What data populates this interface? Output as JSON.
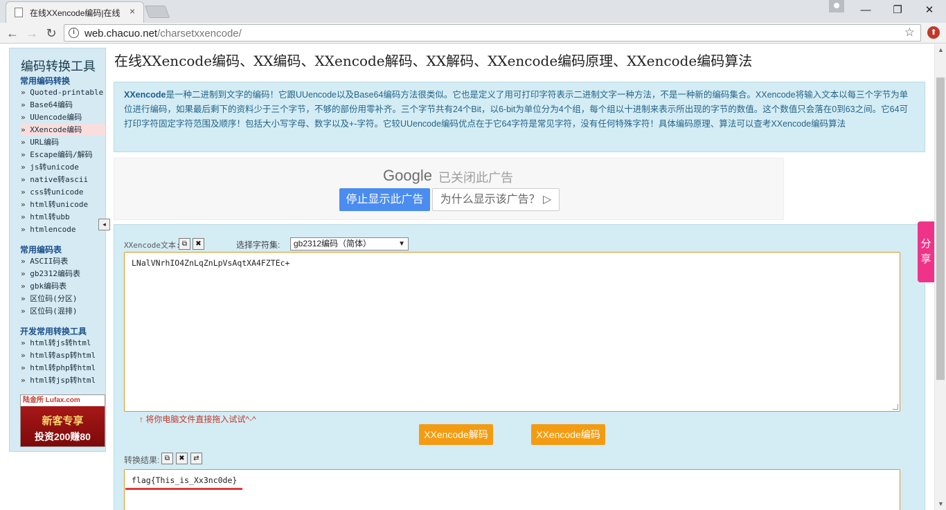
{
  "browser": {
    "tab_title": "在线XXencode编码|在线",
    "tab_close": "×",
    "url_host": "web.chacuo.net",
    "url_path": "/charsetxxencode/",
    "back": "←",
    "forward": "→",
    "reload": "↻",
    "star": "☆",
    "minimize": "—",
    "restore": "❐",
    "close": "✕"
  },
  "sidebar": {
    "title": "编码转换工具",
    "sections": [
      {
        "title": "常用编码转换",
        "items": [
          "Quoted-printable",
          "Base64编码",
          "UUencode编码",
          "XXencode编码",
          "URL编码",
          "Escape编码/解码",
          "js转unicode",
          "native转ascii",
          "css转unicode",
          "html转unicode",
          "html转ubb",
          "htmlencode"
        ]
      },
      {
        "title": "常用编码表",
        "items": [
          "ASCII码表",
          "gb2312编码表",
          "gbk编码表",
          "区位码(分区)",
          "区位码(混排)"
        ]
      },
      {
        "title": "开发常用转换工具",
        "items": [
          "html转js转html",
          "html转asp转html",
          "html转php转html",
          "html转jsp转html"
        ]
      }
    ],
    "ad": {
      "brand": "陆金所 Lufax.com",
      "line1": "新客专享",
      "line2": "投资200赚80"
    },
    "collapse": "◂"
  },
  "main": {
    "title": "在线XXencode编码、XX编码、XXencode解码、XX解码、XXencode编码原理、XXencode编码算法",
    "intro_kw": "XXencode",
    "intro_text": "是一种二进制到文字的编码！它跟UUencode以及Base64编码方法很类似。它也是定义了用可打印字符表示二进制文字一种方法，不是一种新的编码集合。XXencode将输入文本以每三个字节为单位进行编码，如果最后剩下的资料少于三个字节，不够的部份用零补齐。三个字节共有24个Bit，以6-bit为单位分为4个组，每个组以十进制来表示所出现的字节的数值。这个数值只会落在0到63之间。它64可打印字符固定字符范围及顺序！包括大小写字母、数字以及+-字符。它较UUencode编码优点在于它64字符是常见字符，没有任何特殊字符！具体编码原理、算法可以查考XXencode编码算法"
  },
  "ad_closed": {
    "google": "Google",
    "closed": "已关闭此广告",
    "stop": "停止显示此广告",
    "why": "为什么显示该广告？ ▷"
  },
  "tool": {
    "input_label": "XXencode文本:",
    "copy_icon": "⧉",
    "clear_icon": "✖",
    "swap_icon": "⇄",
    "charset_label": "选择字符集:",
    "charset_value": "gb2312编码（简体）",
    "charset_arrow": "▼",
    "input_value": "LNalVNrhIO4ZnLqZnLpVsAqtXA4FZTEc+",
    "hint": "↑ 将你电脑文件直接拖入试试^-^",
    "decode_btn": "XXencode解码",
    "encode_btn": "XXencode编码",
    "result_label": "转换结果:",
    "result_value": "flag{This_is_Xx3nc0de}"
  },
  "share": {
    "label": "分享"
  },
  "scrollbar": {
    "up": "▲",
    "down": "▼"
  }
}
